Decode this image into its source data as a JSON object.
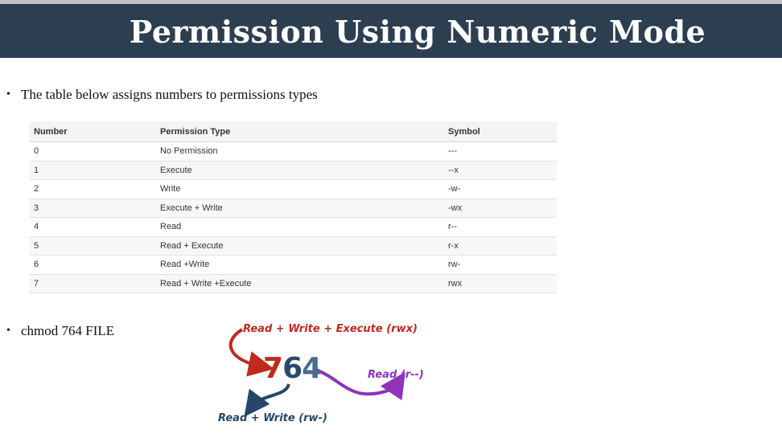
{
  "slide": {
    "title": "Permission Using Numeric Mode",
    "bullet1": "The table below assigns numbers to permissions types",
    "bullet2": "chmod 764 FILE"
  },
  "table": {
    "headers": [
      "Number",
      "Permission Type",
      "Symbol"
    ],
    "rows": [
      [
        "0",
        "No Permission",
        "---"
      ],
      [
        "1",
        "Execute",
        "--x"
      ],
      [
        "2",
        "Write",
        "-w-"
      ],
      [
        "3",
        "Execute + Write",
        "-wx"
      ],
      [
        "4",
        "Read",
        "r--"
      ],
      [
        "5",
        "Read + Execute",
        "r-x"
      ],
      [
        "6",
        "Read +Write",
        "rw-"
      ],
      [
        "7",
        "Read + Write +Execute",
        "rwx"
      ]
    ]
  },
  "diagram": {
    "digit_owner": "7",
    "digit_group": "6",
    "digit_other": "4",
    "label_owner": "Read + Write + Execute (rwx)",
    "label_other": "Read (r--)",
    "label_group": "Read + Write (rw-)",
    "colors": {
      "owner": "#c0291f",
      "group": "#2a4a6b",
      "other": "#8e34b9"
    }
  }
}
